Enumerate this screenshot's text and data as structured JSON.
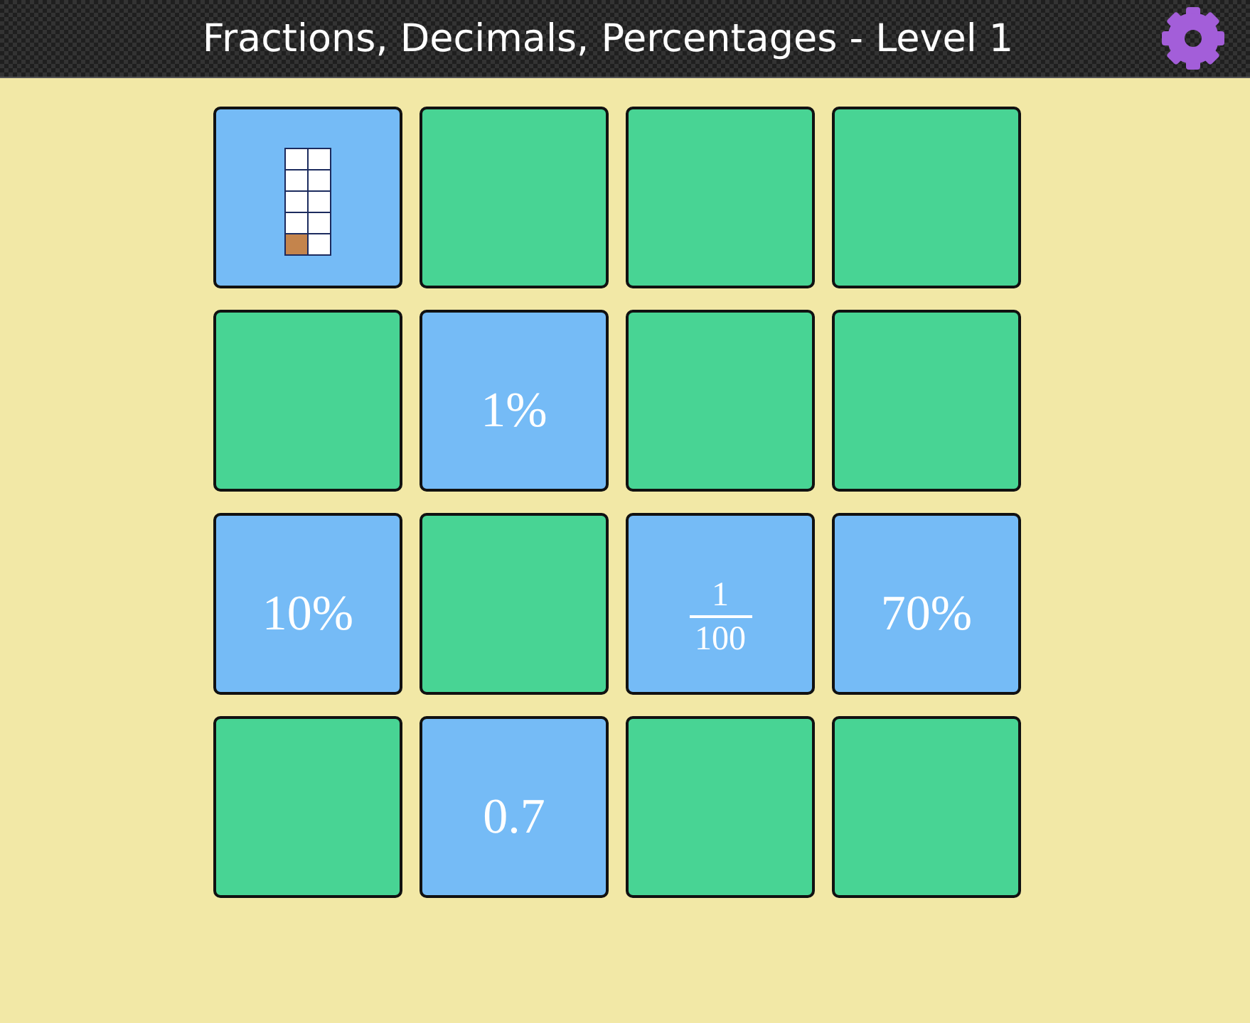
{
  "header": {
    "title": "Fractions, Decimals, Percentages - Level 1"
  },
  "board": {
    "cards": [
      {
        "face_up": true,
        "kind": "grid",
        "grid_rows": [
          {
            "cells": [
              {
                "shaded": false
              },
              {
                "shaded": false
              }
            ]
          },
          {
            "cells": [
              {
                "shaded": false
              },
              {
                "shaded": false
              }
            ]
          },
          {
            "cells": [
              {
                "shaded": false
              },
              {
                "shaded": false
              }
            ]
          },
          {
            "cells": [
              {
                "shaded": false
              },
              {
                "shaded": false
              }
            ]
          },
          {
            "cells": [
              {
                "shaded": true
              },
              {
                "shaded": false
              }
            ]
          }
        ]
      },
      {
        "face_up": false
      },
      {
        "face_up": false
      },
      {
        "face_up": false
      },
      {
        "face_up": false
      },
      {
        "face_up": true,
        "kind": "text",
        "text": "1%"
      },
      {
        "face_up": false
      },
      {
        "face_up": false
      },
      {
        "face_up": true,
        "kind": "text",
        "text": "10%"
      },
      {
        "face_up": false
      },
      {
        "face_up": true,
        "kind": "fraction",
        "numerator": "1",
        "denominator": "100"
      },
      {
        "face_up": true,
        "kind": "text",
        "text": "70%"
      },
      {
        "face_up": false
      },
      {
        "face_up": true,
        "kind": "text",
        "text": "0.7"
      },
      {
        "face_up": false
      },
      {
        "face_up": false
      }
    ]
  }
}
